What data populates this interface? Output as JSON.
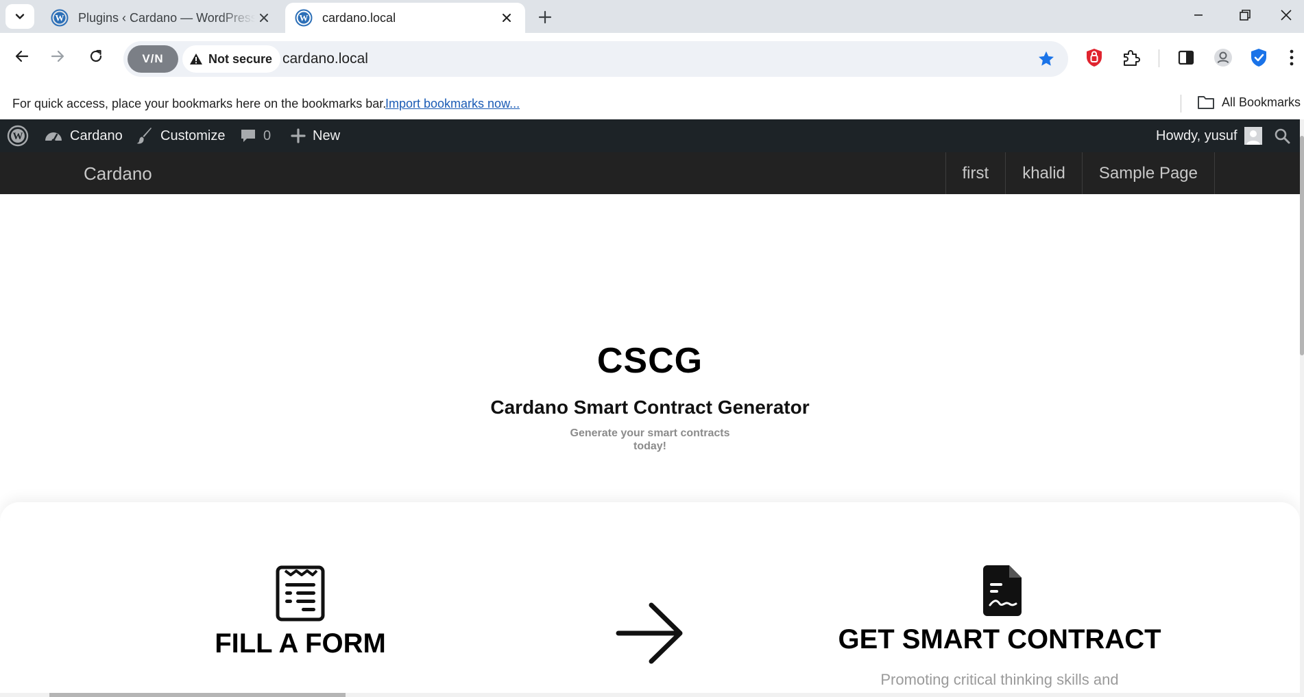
{
  "browser": {
    "tabs": [
      {
        "title": "Plugins ‹ Cardano — WordPress",
        "active": false
      },
      {
        "title": "cardano.local",
        "active": true
      }
    ],
    "vpn_label": "V/N",
    "security_label": "Not secure",
    "url": "cardano.local",
    "bookmarks_message": "For quick access, place your bookmarks here on the bookmarks bar.",
    "bookmarks_link": "Import bookmarks now...",
    "all_bookmarks": "All Bookmarks"
  },
  "adminbar": {
    "site_name": "Cardano",
    "customize": "Customize",
    "comments_count": "0",
    "new_label": "New",
    "howdy": "Howdy, yusuf"
  },
  "site": {
    "title": "Cardano",
    "nav": [
      "first",
      "khalid",
      "Sample Page"
    ]
  },
  "hero": {
    "title": "CSCG",
    "subtitle": "Cardano Smart Contract Generator",
    "tagline_line1": "Generate your smart contracts",
    "tagline_line2": "today!"
  },
  "steps": {
    "step1_title": "FILL A FORM",
    "step2_title": "GET SMART CONTRACT",
    "step2_desc": "Promoting critical thinking skills and"
  },
  "colors": {
    "adminbar_bg": "#1d2327",
    "site_header_bg": "#222222",
    "accent_blue": "#1a73e8",
    "link_blue": "#1a5bb5"
  }
}
